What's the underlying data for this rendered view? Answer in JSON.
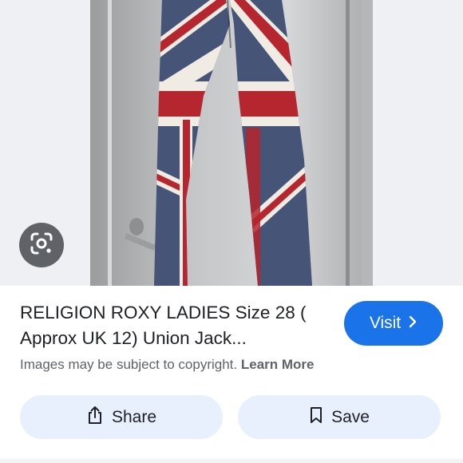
{
  "result": {
    "title": "RELIGION ROXY LADIES Size 28 ( Approx UK 12) Union Jack...",
    "visit_label": "Visit",
    "copyright_notice": "Images may be subject to copyright.",
    "learn_more_label": "Learn More"
  },
  "actions": {
    "share_label": "Share",
    "save_label": "Save"
  },
  "icons": {
    "lens": "google-lens-icon",
    "visit": "chevron-right-icon",
    "share": "share-icon",
    "save": "bookmark-icon"
  },
  "colors": {
    "accent": "#1a73e8",
    "action_button_bg": "#e8f0fe",
    "lens_button_bg": "#5f6368",
    "flag_red": "#b5262e",
    "flag_blue": "#3b4a6e"
  }
}
